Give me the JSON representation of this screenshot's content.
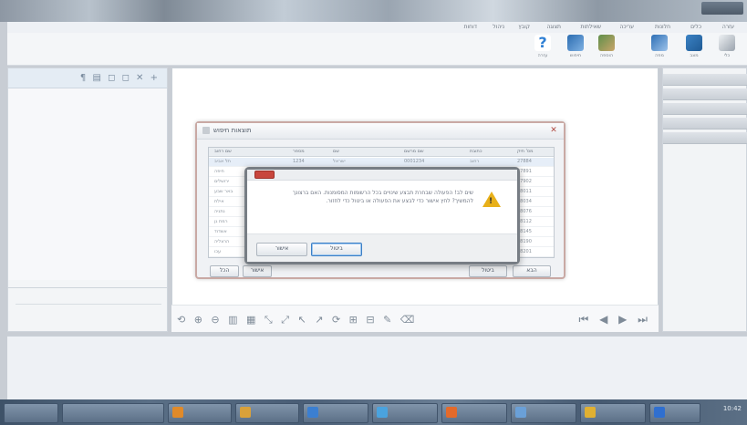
{
  "colors": {
    "accent": "#2b74c7",
    "warning": "#e8b019",
    "close_red": "#c8463d"
  },
  "menu": {
    "items": [
      "עזרה",
      "כלים",
      "חלונות",
      "עריכה",
      "שאילתות",
      "תצוגה",
      "קובץ",
      "ניהול",
      "דוחות",
      "מידע"
    ]
  },
  "toolbar": {
    "buttons": [
      {
        "label": "עזרה",
        "icon": "help-icon",
        "color": "#2e7fd4"
      },
      {
        "label": "חיפוש",
        "icon": "search-icon",
        "color": "#2b6cb0"
      },
      {
        "label": "הוספה",
        "icon": "add-user-icon",
        "color": "#4a7a3a"
      },
      {
        "label": "מפה",
        "icon": "map-icon",
        "color": "#2d6fb5"
      },
      {
        "label": "מצב",
        "icon": "camera-icon",
        "color": "#3b82c4"
      },
      {
        "label": "כלי",
        "icon": "pen-icon",
        "color": "#6b7280"
      }
    ]
  },
  "left_panel": {
    "header_icons": "¶ ▤ ◻ ◻ ✕ +"
  },
  "search_dialog": {
    "title": "תוצאות חיפוש",
    "columns": [
      "שם רחוב",
      "מספר",
      "שם",
      "שם מרשם",
      "כתובת",
      "מס' תיק"
    ],
    "rows": [
      [
        "תל אביב",
        "1234",
        "ישראל",
        "0001234",
        "רחוב",
        "27884"
      ],
      [
        "חיפה",
        "2311",
        "משה",
        "0002311",
        "דרך",
        "27891"
      ],
      [
        "ירושלים",
        "1120",
        "דוד",
        "0001120",
        "שדרות",
        "27902"
      ],
      [
        "באר שבע",
        "4502",
        "רחל",
        "0004502",
        "רחוב",
        "28011"
      ],
      [
        "אילת",
        "3341",
        "שרה",
        "0003341",
        "כיכר",
        "28034"
      ],
      [
        "נתניה",
        "2210",
        "יוסי",
        "0002210",
        "רחוב",
        "28076"
      ],
      [
        "רמת גן",
        "5102",
        "אבי",
        "0005102",
        "דרך",
        "28112"
      ],
      [
        "אשדוד",
        "1903",
        "נועה",
        "0001903",
        "שדרות",
        "28145"
      ],
      [
        "הרצליה",
        "6120",
        "דנה",
        "0006120",
        "רחוב",
        "28190"
      ],
      [
        "עכו",
        "7011",
        "אלי",
        "0007011",
        "כיכר",
        "28201"
      ]
    ],
    "buttons": {
      "all": "הכל",
      "ok": "אישור",
      "cancel": "ביטול",
      "next": "הבא"
    }
  },
  "alert_dialog": {
    "message": "שים לב! הפעולה שבחרת תבצע שינויים בכל הרשומות המסומנות. האם ברצונך להמשיך? לחץ אישור כדי לבצע את הפעולה או ביטול כדי לחזור.",
    "ok": "אישור",
    "cancel": "ביטול"
  },
  "navigation": {
    "tools": "⟲ ⊕ ⊖ ▥ ▦ ⤡ ⤢ ↖ ↗ ⟳ ⊞ ⊟ ✎ ⌫",
    "paging": "⏮ ◀ ▶ ⏭"
  },
  "taskbar": {
    "clock": "10:42"
  }
}
